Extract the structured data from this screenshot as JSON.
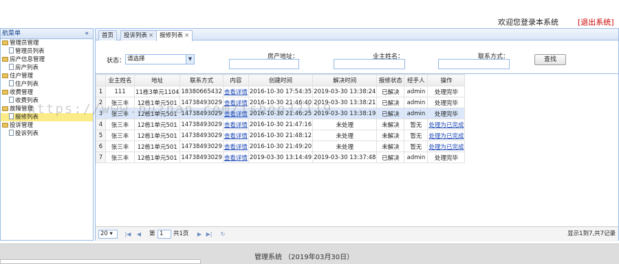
{
  "header": {
    "welcome": "欢迎您登录本系统",
    "logout": "[退出系统]"
  },
  "sidebar": {
    "title": "航菜单",
    "collapse_icon": "«",
    "items": [
      {
        "label": "管理员管理",
        "type": "folder"
      },
      {
        "label": "管理员列表",
        "type": "leaf"
      },
      {
        "label": "房产信息管理",
        "type": "folder"
      },
      {
        "label": "房产列表",
        "type": "leaf"
      },
      {
        "label": "住户管理",
        "type": "folder"
      },
      {
        "label": "住户列表",
        "type": "leaf"
      },
      {
        "label": "收费管理",
        "type": "folder"
      },
      {
        "label": "收费列表",
        "type": "leaf"
      },
      {
        "label": "故障管理",
        "type": "folder"
      },
      {
        "label": "报修列表",
        "type": "leaf",
        "selected": true
      },
      {
        "label": "投诉管理",
        "type": "folder"
      },
      {
        "label": "投诉列表",
        "type": "leaf"
      }
    ]
  },
  "tabs": [
    {
      "label": "首页",
      "closable": false
    },
    {
      "label": "投诉列表",
      "closable": true
    },
    {
      "label": "报修列表",
      "closable": true,
      "active": true
    }
  ],
  "filter": {
    "status_label": "状态：",
    "status_value": "请选择",
    "address_label": "房产地址：",
    "owner_label": "业主姓名：",
    "contact_label": "联系方式：",
    "search_button": "查找"
  },
  "grid": {
    "columns": [
      "业主姓名",
      "地址",
      "联系方式",
      "内容",
      "创建时间",
      "解决时间",
      "报修状态",
      "经手人",
      "操作"
    ],
    "rows": [
      [
        "1",
        "111",
        "11栋3单元1104",
        "18380665432",
        "查看详情",
        "2016-10-30 17:54:35",
        "2019-03-30 13:38:24",
        "已解决",
        "admin",
        "处理完毕"
      ],
      [
        "2",
        "张三丰",
        "12栋1单元501",
        "14738493029",
        "查看详情",
        "2016-10-30 21:46:40",
        "2019-03-30 13:38:21",
        "已解决",
        "admin",
        "处理完毕"
      ],
      [
        "3",
        "张三丰",
        "12栋1单元501",
        "14738493029",
        "查看详情",
        "2016-10-30 21:46:25",
        "2019-03-30 13:38:19",
        "已解决",
        "admin",
        "处理完毕"
      ],
      [
        "4",
        "张三丰",
        "12栋1单元501",
        "14738493029",
        "查看详情",
        "2016-10-30 21:47:16",
        "未处理",
        "未解决",
        "暂无",
        "处理为已完成"
      ],
      [
        "5",
        "张三丰",
        "12栋1单元501",
        "14738493029",
        "查看详情",
        "2016-10-30 21:48:12",
        "未处理",
        "未解决",
        "暂无",
        "处理为已完成"
      ],
      [
        "6",
        "张三丰",
        "12栋1单元501",
        "14738493029",
        "查看详情",
        "2016-10-30 21:49:20",
        "未处理",
        "未解决",
        "暂无",
        "处理为已完成"
      ],
      [
        "7",
        "张三丰",
        "12栋1单元501",
        "14738493029",
        "查看详情",
        "2019-03-30 13:14:49",
        "2019-03-30 13:37:48",
        "已解决",
        "admin",
        "处理完毕"
      ]
    ]
  },
  "pager": {
    "page_size": "20",
    "page_prefix": "第",
    "page_value": "1",
    "page_suffix": "共1页",
    "summary": "显示1到7,共7记录"
  },
  "footer": {
    "text": "管理系统 （2019年03月30日）"
  },
  "watermark": "https://www.huzhan.com/ishop32119"
}
